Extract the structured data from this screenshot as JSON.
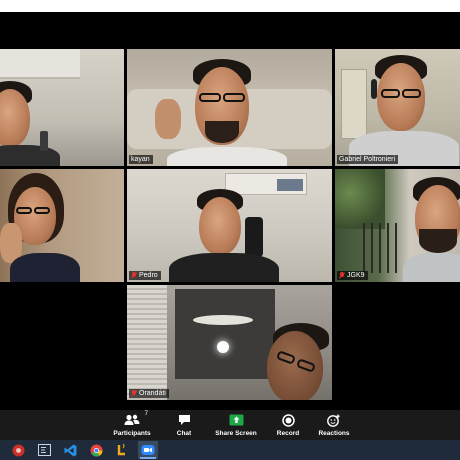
{
  "gallery": {
    "tiles": [
      {
        "id": "tile-1",
        "name": "",
        "muted": false,
        "active": false,
        "bg": "#c9c6bd"
      },
      {
        "id": "tile-2",
        "name": "kayan",
        "muted": false,
        "active": false,
        "bg": "#b5ada0"
      },
      {
        "id": "tile-3",
        "name": "Gabriel Poltronieri",
        "muted": false,
        "active": true,
        "bg": "#c8c2b2"
      },
      {
        "id": "tile-4",
        "name": "",
        "muted": false,
        "active": false,
        "bg": "#a88c72"
      },
      {
        "id": "tile-5",
        "name": "Pedro",
        "muted": true,
        "active": false,
        "bg": "#d2cdc4"
      },
      {
        "id": "tile-6",
        "name": "JGK9",
        "muted": true,
        "active": false,
        "bg": "#4a5a3e"
      },
      {
        "id": "tile-7",
        "name": "Orandáti",
        "muted": true,
        "active": false,
        "bg": "#9a9590"
      }
    ]
  },
  "toolbar": {
    "participants_label": "Participants",
    "participants_count": "7",
    "chat_label": "Chat",
    "share_label": "Share Screen",
    "record_label": "Record",
    "reactions_label": "Reactions",
    "share_color": "#1fa84a"
  },
  "taskbar": {
    "icons": [
      "chrome-red-icon",
      "file-explorer-icon",
      "vscode-icon",
      "chrome-icon",
      "java-icon",
      "zoom-icon"
    ]
  }
}
